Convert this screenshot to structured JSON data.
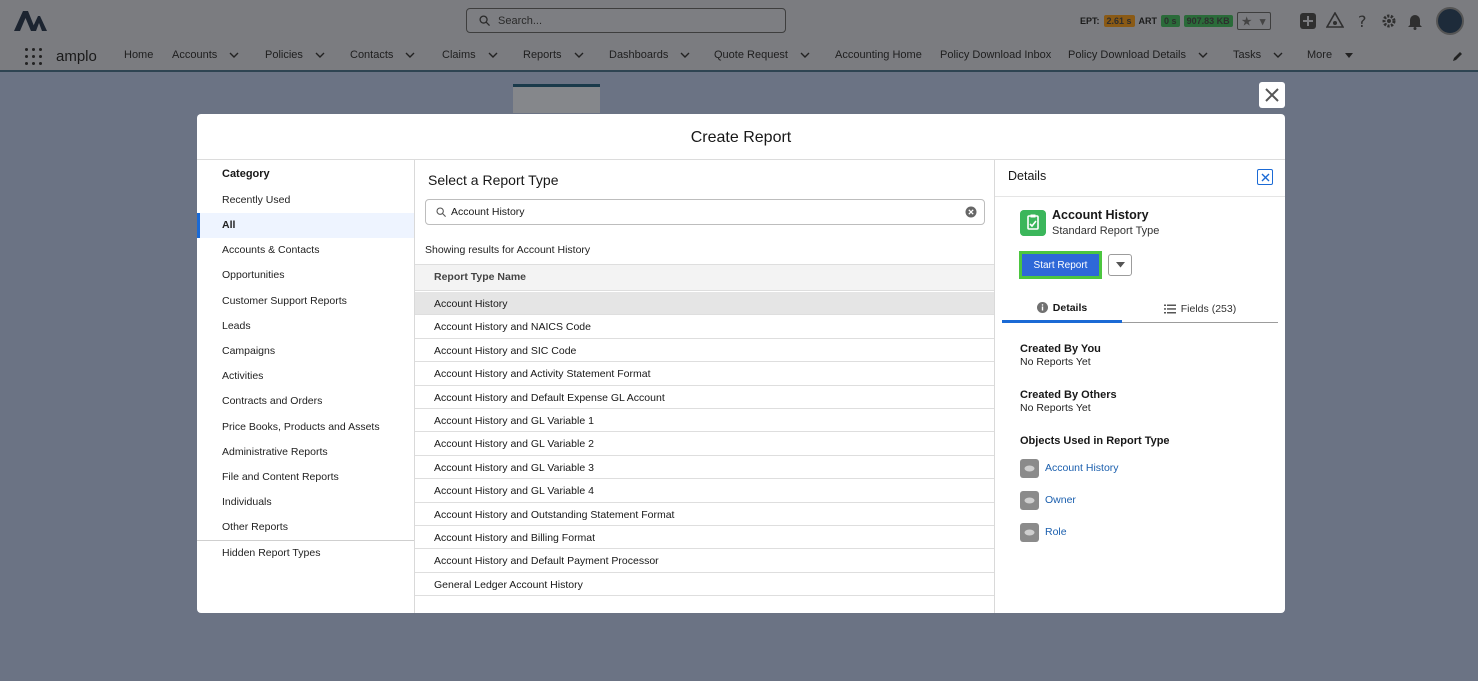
{
  "header": {
    "search_placeholder": "Search...",
    "metrics": {
      "ept_label": "EPT:",
      "ept_value": "2.61 s",
      "art_label": "ART",
      "art_value": "0 s",
      "size_value": "907.83 KB"
    }
  },
  "nav": {
    "app_name": "amplo",
    "items": [
      {
        "label": "Home"
      },
      {
        "label": "Accounts"
      },
      {
        "label": "Policies"
      },
      {
        "label": "Contacts"
      },
      {
        "label": "Claims"
      },
      {
        "label": "Reports"
      },
      {
        "label": "Dashboards"
      },
      {
        "label": "Quote Request"
      },
      {
        "label": "Accounting Home"
      },
      {
        "label": "Policy Download Inbox"
      },
      {
        "label": "Policy Download Details"
      },
      {
        "label": "Tasks"
      },
      {
        "label": "More"
      }
    ]
  },
  "modal": {
    "title": "Create Report",
    "category": {
      "heading": "Category",
      "items": [
        "Recently Used",
        "All",
        "Accounts & Contacts",
        "Opportunities",
        "Customer Support Reports",
        "Leads",
        "Campaigns",
        "Activities",
        "Contracts and Orders",
        "Price Books, Products and Assets",
        "Administrative Reports",
        "File and Content Reports",
        "Individuals",
        "Other Reports"
      ],
      "active": "All",
      "hidden": "Hidden Report Types"
    },
    "types": {
      "title": "Select a Report Type",
      "search_value": "Account History",
      "results_text": "Showing results for Account History",
      "column_header": "Report Type Name",
      "rows": [
        "Account History",
        "Account History and NAICS Code",
        "Account History and SIC Code",
        "Account History and Activity Statement Format",
        "Account History and Default Expense GL Account",
        "Account History and GL Variable 1",
        "Account History and GL Variable 2",
        "Account History and GL Variable 3",
        "Account History and GL Variable 4",
        "Account History and Outstanding Statement Format",
        "Account History and Billing Format",
        "Account History and Default Payment Processor",
        "General Ledger Account History"
      ]
    },
    "details": {
      "heading": "Details",
      "report_type_name": "Account History",
      "report_type_sub": "Standard Report Type",
      "start_label": "Start Report",
      "tab_details": "Details",
      "tab_fields": "Fields (253)",
      "created_by_you": "Created By You",
      "created_by_you_val": "No Reports Yet",
      "created_by_others": "Created By Others",
      "created_by_others_val": "No Reports Yet",
      "objects_title": "Objects Used in Report Type",
      "objects": [
        "Account History",
        "Owner",
        "Role"
      ]
    }
  }
}
